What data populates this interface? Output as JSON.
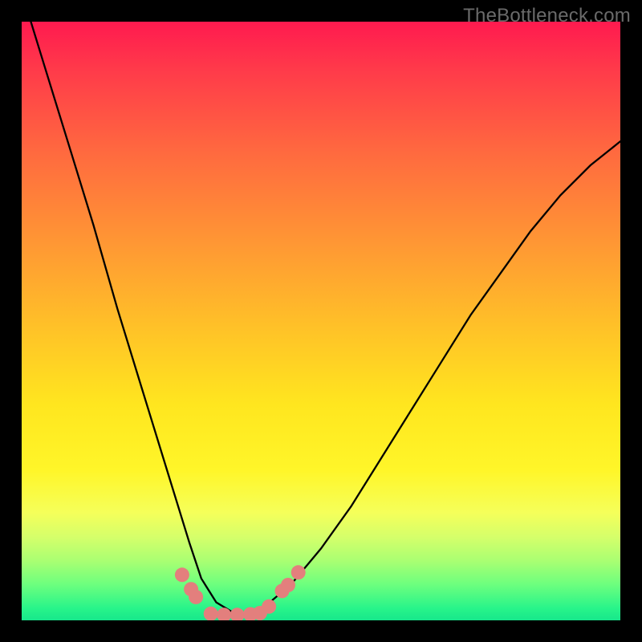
{
  "watermark": "TheBottleneck.com",
  "chart_data": {
    "type": "line",
    "title": "",
    "xlabel": "",
    "ylabel": "",
    "xlim": [
      0,
      1
    ],
    "ylim": [
      0,
      1
    ],
    "series": [
      {
        "name": "curve",
        "x": [
          0.0,
          0.04,
          0.08,
          0.12,
          0.16,
          0.2,
          0.24,
          0.28,
          0.3,
          0.325,
          0.35,
          0.375,
          0.4,
          0.45,
          0.5,
          0.55,
          0.6,
          0.65,
          0.7,
          0.75,
          0.8,
          0.85,
          0.9,
          0.95,
          1.0
        ],
        "values": [
          1.05,
          0.92,
          0.79,
          0.66,
          0.52,
          0.39,
          0.26,
          0.13,
          0.07,
          0.03,
          0.015,
          0.012,
          0.018,
          0.06,
          0.12,
          0.19,
          0.27,
          0.35,
          0.43,
          0.51,
          0.58,
          0.65,
          0.71,
          0.76,
          0.8
        ]
      }
    ],
    "markers": [
      {
        "x": 0.268,
        "y": 0.076
      },
      {
        "x": 0.283,
        "y": 0.052
      },
      {
        "x": 0.291,
        "y": 0.039
      },
      {
        "x": 0.316,
        "y": 0.011
      },
      {
        "x": 0.338,
        "y": 0.009
      },
      {
        "x": 0.36,
        "y": 0.009
      },
      {
        "x": 0.382,
        "y": 0.01
      },
      {
        "x": 0.398,
        "y": 0.012
      },
      {
        "x": 0.413,
        "y": 0.023
      },
      {
        "x": 0.435,
        "y": 0.049
      },
      {
        "x": 0.445,
        "y": 0.059
      },
      {
        "x": 0.462,
        "y": 0.08
      }
    ],
    "marker_color": "#e37f7d",
    "curve_color": "#000000",
    "gradient_stops": [
      {
        "pos": 0.0,
        "color": "#ff1a4f"
      },
      {
        "pos": 0.5,
        "color": "#ffd427"
      },
      {
        "pos": 0.82,
        "color": "#f5ff5a"
      },
      {
        "pos": 1.0,
        "color": "#17e78b"
      }
    ]
  }
}
